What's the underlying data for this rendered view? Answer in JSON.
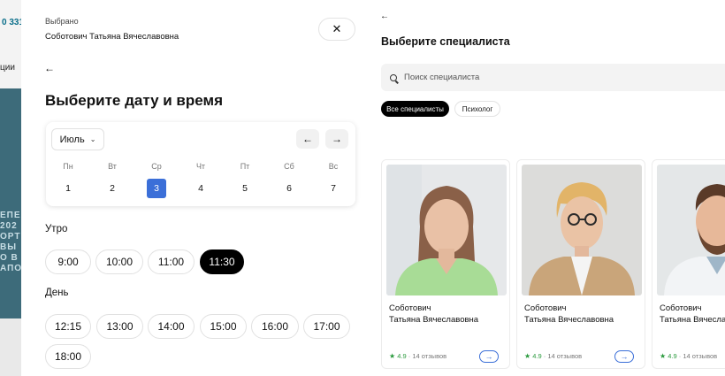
{
  "background": {
    "phone_fragment": "0 331",
    "nav_fragment": "ции",
    "banner_fragments": [
      "ЕПЕ",
      "202",
      "ОРТ",
      "ВЫ",
      "О В",
      "АПО"
    ]
  },
  "booking": {
    "selected_caption": "Выбрано",
    "selected_name": "Соботович Татьяна Вячеславовна",
    "close_icon": "✕",
    "back_icon": "←",
    "title": "Выберите дату и время",
    "calendar": {
      "month": "Июль",
      "prev_icon": "←",
      "next_icon": "→",
      "weekdays": [
        "Пн",
        "Вт",
        "Ср",
        "Чт",
        "Пт",
        "Сб",
        "Вс"
      ],
      "days": [
        "1",
        "2",
        "3",
        "4",
        "5",
        "6",
        "7"
      ],
      "selected_day": "3"
    },
    "morning_label": "Утро",
    "morning_slots": [
      "9:00",
      "10:00",
      "11:00",
      "11:30"
    ],
    "morning_selected": "11:30",
    "day_label": "День",
    "day_slots": [
      "12:15",
      "13:00",
      "14:00",
      "15:00",
      "16:00",
      "17:00",
      "18:00"
    ]
  },
  "specialists": {
    "back_icon": "←",
    "title": "Выберите специалиста",
    "search_placeholder": "Поиск специалиста",
    "filters": [
      "Все специалисты",
      "Психолог"
    ],
    "active_filter": "Все специалисты",
    "cards": [
      {
        "name_line1": "Соботович",
        "name_line2": "Татьяна Вячеславовна",
        "rating": "4.9",
        "reviews": "· 14 отзывов",
        "arrow": "→"
      },
      {
        "name_line1": "Соботович",
        "name_line2": "Татьяна Вячеславовна",
        "rating": "4.9",
        "reviews": "· 14 отзывов",
        "arrow": "→"
      },
      {
        "name_line1": "Соботович",
        "name_line2": "Татьяна Вячеславовна",
        "rating": "4.9",
        "reviews": "· 14 отзывов",
        "arrow": "→"
      }
    ]
  },
  "colors": {
    "accent": "#3b6fd8",
    "selected_slot": "#000000",
    "rating_green": "#2a9a3d"
  }
}
